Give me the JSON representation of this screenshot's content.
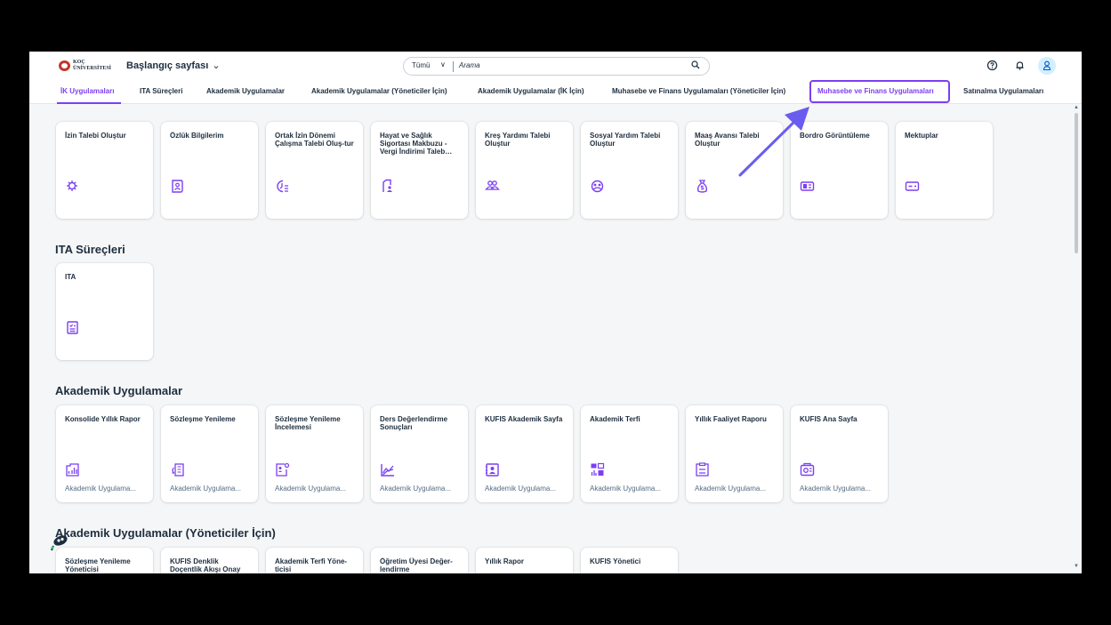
{
  "shellbar": {
    "logo_text": "KOÇ\nÜNİVERSİTESİ",
    "page_title": "Başlangıç sayfası",
    "search_scope": "Tümü",
    "search_placeholder": "Arama"
  },
  "tabs": [
    {
      "label": "İK Uygulamaları",
      "active": true
    },
    {
      "label": "ITA Süreçleri"
    },
    {
      "label": "Akademik Uygulamalar"
    },
    {
      "label": "Akademik Uygulamalar (Yöneticiler İçin)"
    },
    {
      "label": "Akademik Uygulamalar (İK İçin)"
    },
    {
      "label": "Muhasebe ve Finans Uygulamaları (Yöneticiler İçin)"
    },
    {
      "label": "Muhasebe ve Finans Uygulamaları",
      "highlighted": true
    },
    {
      "label": "Satınalma Uygulamaları"
    }
  ],
  "sections": {
    "ik": {
      "tiles": [
        {
          "title": "İzin Talebi Oluştur",
          "icon": "virus-icon"
        },
        {
          "title": "Özlük Bilgilerim",
          "icon": "id-card-icon"
        },
        {
          "title": "Ortak İzin Dönemi Çalışma Talebi Oluş-tur",
          "icon": "clock-list-icon"
        },
        {
          "title": "Hayat ve Sağlık Sigortası Makbuzu - Vergi İndirimi Taleb…",
          "icon": "document-people-icon"
        },
        {
          "title": "Kreş Yardımı Talebi Oluştur",
          "icon": "group-icon"
        },
        {
          "title": "Sosyal Yardım Talebi Oluştur",
          "icon": "people-circle-icon"
        },
        {
          "title": "Maaş Avansı Talebi Oluştur",
          "icon": "money-bag-icon"
        },
        {
          "title": "Bordro Görüntüleme",
          "icon": "payroll-icon"
        },
        {
          "title": "Mektuplar",
          "icon": "card-icon"
        }
      ]
    },
    "ita": {
      "title": "ITA Süreçleri",
      "tiles": [
        {
          "title": "ITA",
          "icon": "checklist-icon"
        }
      ]
    },
    "akademik": {
      "title": "Akademik Uygulamalar",
      "tiles": [
        {
          "title": "Konsolide Yıllık Rapor",
          "subtitle": "Akademik Uygulama...",
          "icon": "report-icon"
        },
        {
          "title": "Sözleşme Yenileme",
          "subtitle": "Akademik Uygulama...",
          "icon": "renew-doc-icon"
        },
        {
          "title": "Sözleşme Yenileme İncelemesi",
          "subtitle": "Akademik Uygulama...",
          "icon": "review-doc-icon"
        },
        {
          "title": "Ders Değerlendirme Sonuçları",
          "subtitle": "Akademik Uygulama...",
          "icon": "line-chart-icon"
        },
        {
          "title": "KUFIS Akademik Sayfa",
          "subtitle": "Akademik Uygulama...",
          "icon": "person-book-icon"
        },
        {
          "title": "Akademik Terfi",
          "subtitle": "Akademik Uygulama...",
          "icon": "dashboard-icon"
        },
        {
          "title": "Yıllık Faaliyet Raporu",
          "subtitle": "Akademik Uygulama...",
          "icon": "activity-report-icon"
        },
        {
          "title": "KUFIS Ana Sayfa",
          "subtitle": "Akademik Uygulama...",
          "icon": "home-screen-icon"
        }
      ]
    },
    "akademik_yonetici": {
      "title": "Akademik Uygulamalar (Yöneticiler İçin)",
      "tiles": [
        {
          "title": "Sözleşme Yenileme Yöneticisi"
        },
        {
          "title": "KUFIS Denklik Doçentlik Akışı Onay"
        },
        {
          "title": "Akademik Terfi Yöne-ticisi"
        },
        {
          "title": "Öğretim Üyesi Değer-lendirme"
        },
        {
          "title": "Yıllık Rapor"
        },
        {
          "title": "KUFIS Yönetici"
        }
      ]
    }
  },
  "colors": {
    "accent": "#7b3ff2",
    "text": "#1d2d3e",
    "background": "#f5f6f7"
  }
}
